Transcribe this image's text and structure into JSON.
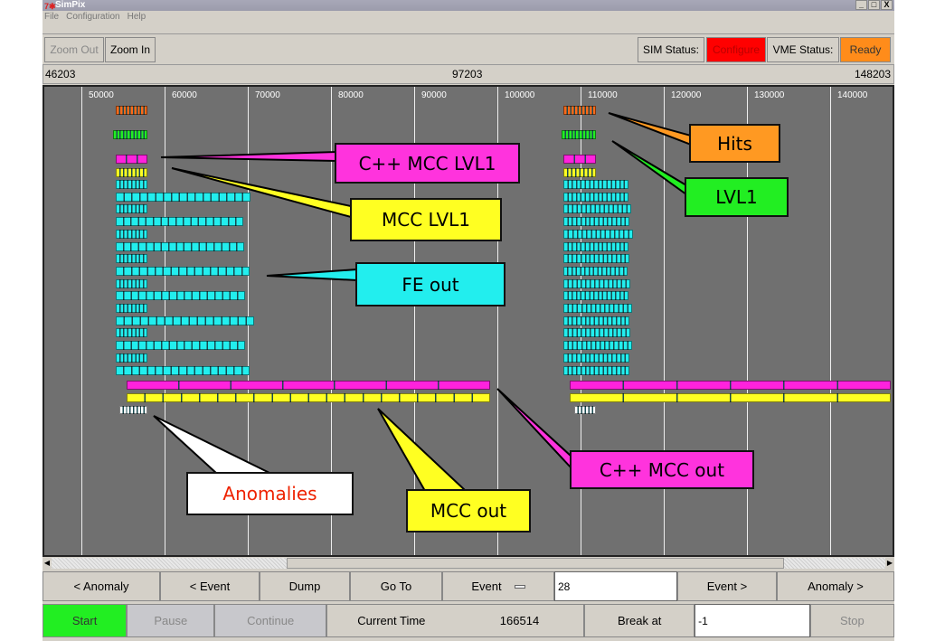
{
  "window": {
    "title": "SimPix",
    "controls": [
      "_",
      "□",
      "X"
    ]
  },
  "menu": [
    "File",
    "Configuration",
    "Help"
  ],
  "toolbar": {
    "zoom_out": "Zoom Out",
    "zoom_in": "Zoom In",
    "sim_status_label": "SIM Status:",
    "sim_status": "Configure",
    "vme_status_label": "VME Status:",
    "vme_status": "Ready",
    "colors": {
      "configure": "#ff0000",
      "ready": "#ff8c1a"
    }
  },
  "ruler": {
    "left": "46203",
    "center": "97203",
    "right": "148203"
  },
  "timeline": {
    "ticks": [
      "50000",
      "60000",
      "70000",
      "80000",
      "90000",
      "100000",
      "110000",
      "120000",
      "130000",
      "140000"
    ],
    "track_colors": {
      "hits": "#ff6a1a",
      "lvl1": "#22ee22",
      "cpp_mcc": "#ff22dd",
      "mcc": "#ffff22",
      "fe": "#22eeee",
      "anomaly": "#ffffff"
    }
  },
  "callouts": {
    "cpp_mcc_lvl1": "C++ MCC LVL1",
    "mcc_lvl1": "MCC LVL1",
    "fe_out": "FE out",
    "hits": "Hits",
    "lvl1": "LVL1",
    "cpp_mcc_out": "C++ MCC out",
    "mcc_out": "MCC out",
    "anomalies": "Anomalies"
  },
  "nav": {
    "prev_anomaly": "< Anomaly",
    "prev_event": "< Event",
    "dump": "Dump",
    "goto": "Go To",
    "mode": "Event",
    "event_value": "28",
    "next_event": "Event >",
    "next_anomaly": "Anomaly >"
  },
  "control": {
    "start": "Start",
    "pause": "Pause",
    "continue": "Continue",
    "current_time_label": "Current Time",
    "current_time": "166514",
    "break_at_label": "Break at",
    "break_at_value": "-1",
    "stop": "Stop"
  }
}
